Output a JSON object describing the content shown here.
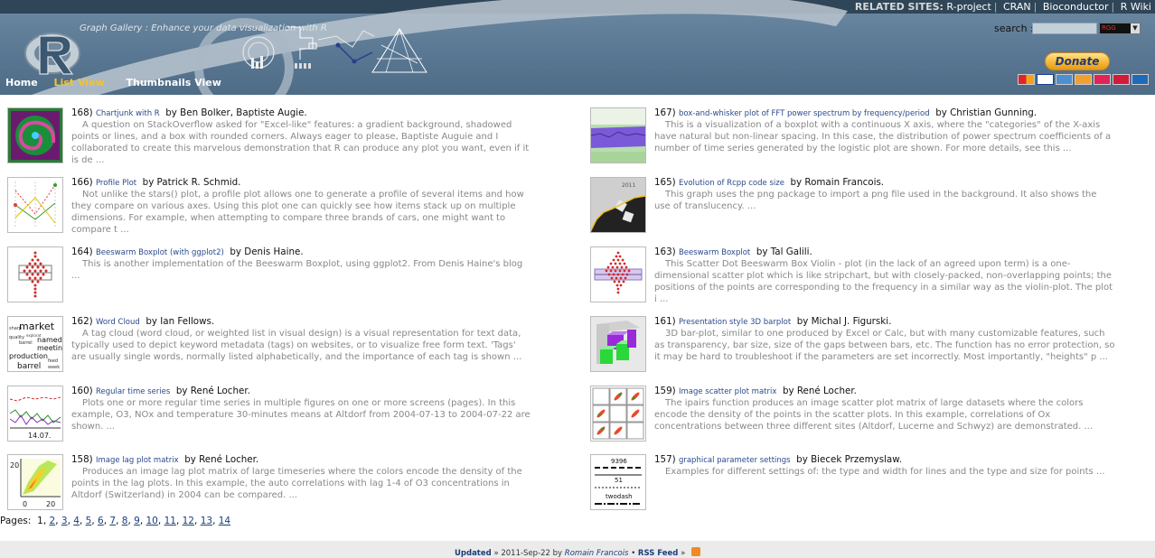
{
  "header": {
    "related_label": "RELATED SITES:",
    "related_links": [
      "R-project",
      "CRAN",
      "Bioconductor",
      "R Wiki"
    ],
    "tagline": "Graph Gallery : Enhance your data visualization with R",
    "nav": {
      "home": "Home",
      "list": "List View",
      "thumbnails": "Thumbnails View"
    },
    "search_label": "search :",
    "search_select": "RGG",
    "donate": "Donate",
    "colors": {
      "header_bg": "#5a7893",
      "nav_active": "#f2c230",
      "topbar": "#2f4658"
    }
  },
  "entries": [
    {
      "num": "168)",
      "link": "Chartjunk with R",
      "by": "by Ben Bolker, Baptiste Augie.",
      "desc": "A question on StackOverflow asked for \"Excel-like\" features: a gradient background, shadowed points or lines, and a box with rounded corners. Always eager to please, Baptiste Auguie and I collaborated to create this marvelous demonstration that R can produce any plot you want, even if it is de ...",
      "icon": "spiral-thumbnail"
    },
    {
      "num": "167)",
      "link": "box-and-whisker plot of FFT power spectrum by frequency/period",
      "by": "by Christian Gunning.",
      "desc": "This is a visualization of a boxplot with a continuous X axis, where the \"categories\" of the X-axis have natural but non-linear spacing. In this case, the distribution of power spectrum coefficients of a number of time series generated by the logistic plot are shown. For more details, see this ...",
      "icon": "band-thumbnail"
    },
    {
      "num": "166)",
      "link": "Profile Plot",
      "by": "by Patrick R. Schmid.",
      "desc": "Not unlike the stars() plot, a profile plot allows one to generate a profile of several items and how they compare on various axes. Using this plot one can quickly see how items stack up on multiple dimensions. For example, when attempting to compare three brands of cars, one might want to compare t ...",
      "icon": "profile-thumbnail"
    },
    {
      "num": "165)",
      "link": "Evolution of Rcpp code size",
      "by": "by Romain Francois.",
      "desc": "This graph uses the png package to import a png file used in the background. It also shows the use of translucency. ...",
      "icon": "rcpp-thumbnail"
    },
    {
      "num": "164)",
      "link": "Beeswarm Boxplot (with ggplot2)",
      "by": "by Denis Haine.",
      "desc": "This is another implementation of the Beeswarm Boxplot, using ggplot2. From Denis Haine's blog ...",
      "icon": "beeswarm-thumbnail"
    },
    {
      "num": "163)",
      "link": "Beeswarm Boxplot",
      "by": "by Tal Galili.",
      "desc": "This Scatter Dot Beeswarm Box Violin - plot (in the lack of an agreed upon term) is a one-dimensional scatter plot which is like stripchart, but with closely-packed, non-overlapping points; the positions of the points are corresponding to the frequency in a similar way as the violin-plot. The plot i ...",
      "icon": "beeswarm2-thumbnail"
    },
    {
      "num": "162)",
      "link": "Word Cloud",
      "by": "by Ian Fellows.",
      "desc": "A tag cloud (word cloud, or weighted list in visual design) is a visual representation for text data, typically used to depict keyword metadata (tags) on websites, or to visualize free form text. 'Tags' are usually single words, normally listed alphabetically, and the importance of each tag is shown ...",
      "icon": "wordcloud-thumbnail"
    },
    {
      "num": "161)",
      "link": "Presentation style 3D barplot",
      "by": "by Michal J. Figurski.",
      "desc": "3D bar-plot, similar to one produced by Excel or Calc, but with many customizable features, such as transparency, bar size, size of the gaps between bars, etc. The function has no error protection, so it may be hard to troubleshoot if the parameters are set incorrectly. Most importantly, \"heights\" p ...",
      "icon": "barplot3d-thumbnail"
    },
    {
      "num": "160)",
      "link": "Regular time series",
      "by": "by René Locher.",
      "desc": "Plots one or more regular time series in multiple figures on one or more screens (pages). In this example, O3, NOx and temperature 30-minutes means at Altdorf from 2004-07-13 to 2004-07-22 are shown. ...",
      "icon": "timeseries-thumbnail"
    },
    {
      "num": "159)",
      "link": "Image scatter plot matrix",
      "by": "by René Locher.",
      "desc": "The ipairs function produces an image scatter plot matrix of large datasets where the colors encode the density of the points in the scatter plots. In this example, correlations of Ox concentrations between three different sites (Altdorf, Lucerne and Schwyz) are demonstrated. ...",
      "icon": "scattermatrix-thumbnail"
    },
    {
      "num": "158)",
      "link": "Image lag plot matrix",
      "by": "by René Locher.",
      "desc": "Produces an image lag plot matrix of large timeseries where the colors encode the density of the points in the lag plots. In this example, the auto correlations with lag 1-4 of O3 concentrations in Altdorf (Switzerland) in 2004 can be compared. ...",
      "icon": "lagplot-thumbnail"
    },
    {
      "num": "157)",
      "link": "graphical parameter settings",
      "by": "by Biecek Przemyslaw.",
      "desc": "Examples for different settings of: the type and width for lines and the type and size for points ...",
      "icon": "params-thumbnail"
    }
  ],
  "thumb_text": {
    "ts_date": "14.07.",
    "lag_y20": "20",
    "lag_x0": "0",
    "lag_x20": "20",
    "params_a": "9396",
    "params_b": "51",
    "params_c": "twodash",
    "rcpp_year": "2011",
    "wc_words": [
      "sharp",
      "market",
      "meetin",
      "production",
      "barrel",
      "named",
      "explorat",
      "feed",
      "week",
      "quality"
    ]
  },
  "pages": {
    "label": "Pages:",
    "current": "1",
    "links": [
      "2",
      "3",
      "4",
      "5",
      "6",
      "7",
      "8",
      "9",
      "10",
      "11",
      "12",
      "13",
      "14"
    ]
  },
  "footer": {
    "updated": "Updated",
    "sep": "»",
    "date": "2011-Sep-22",
    "by": "by",
    "author": "Romain Francois",
    "bullet": "•",
    "rss": "RSS Feed",
    "sep2": "»"
  }
}
